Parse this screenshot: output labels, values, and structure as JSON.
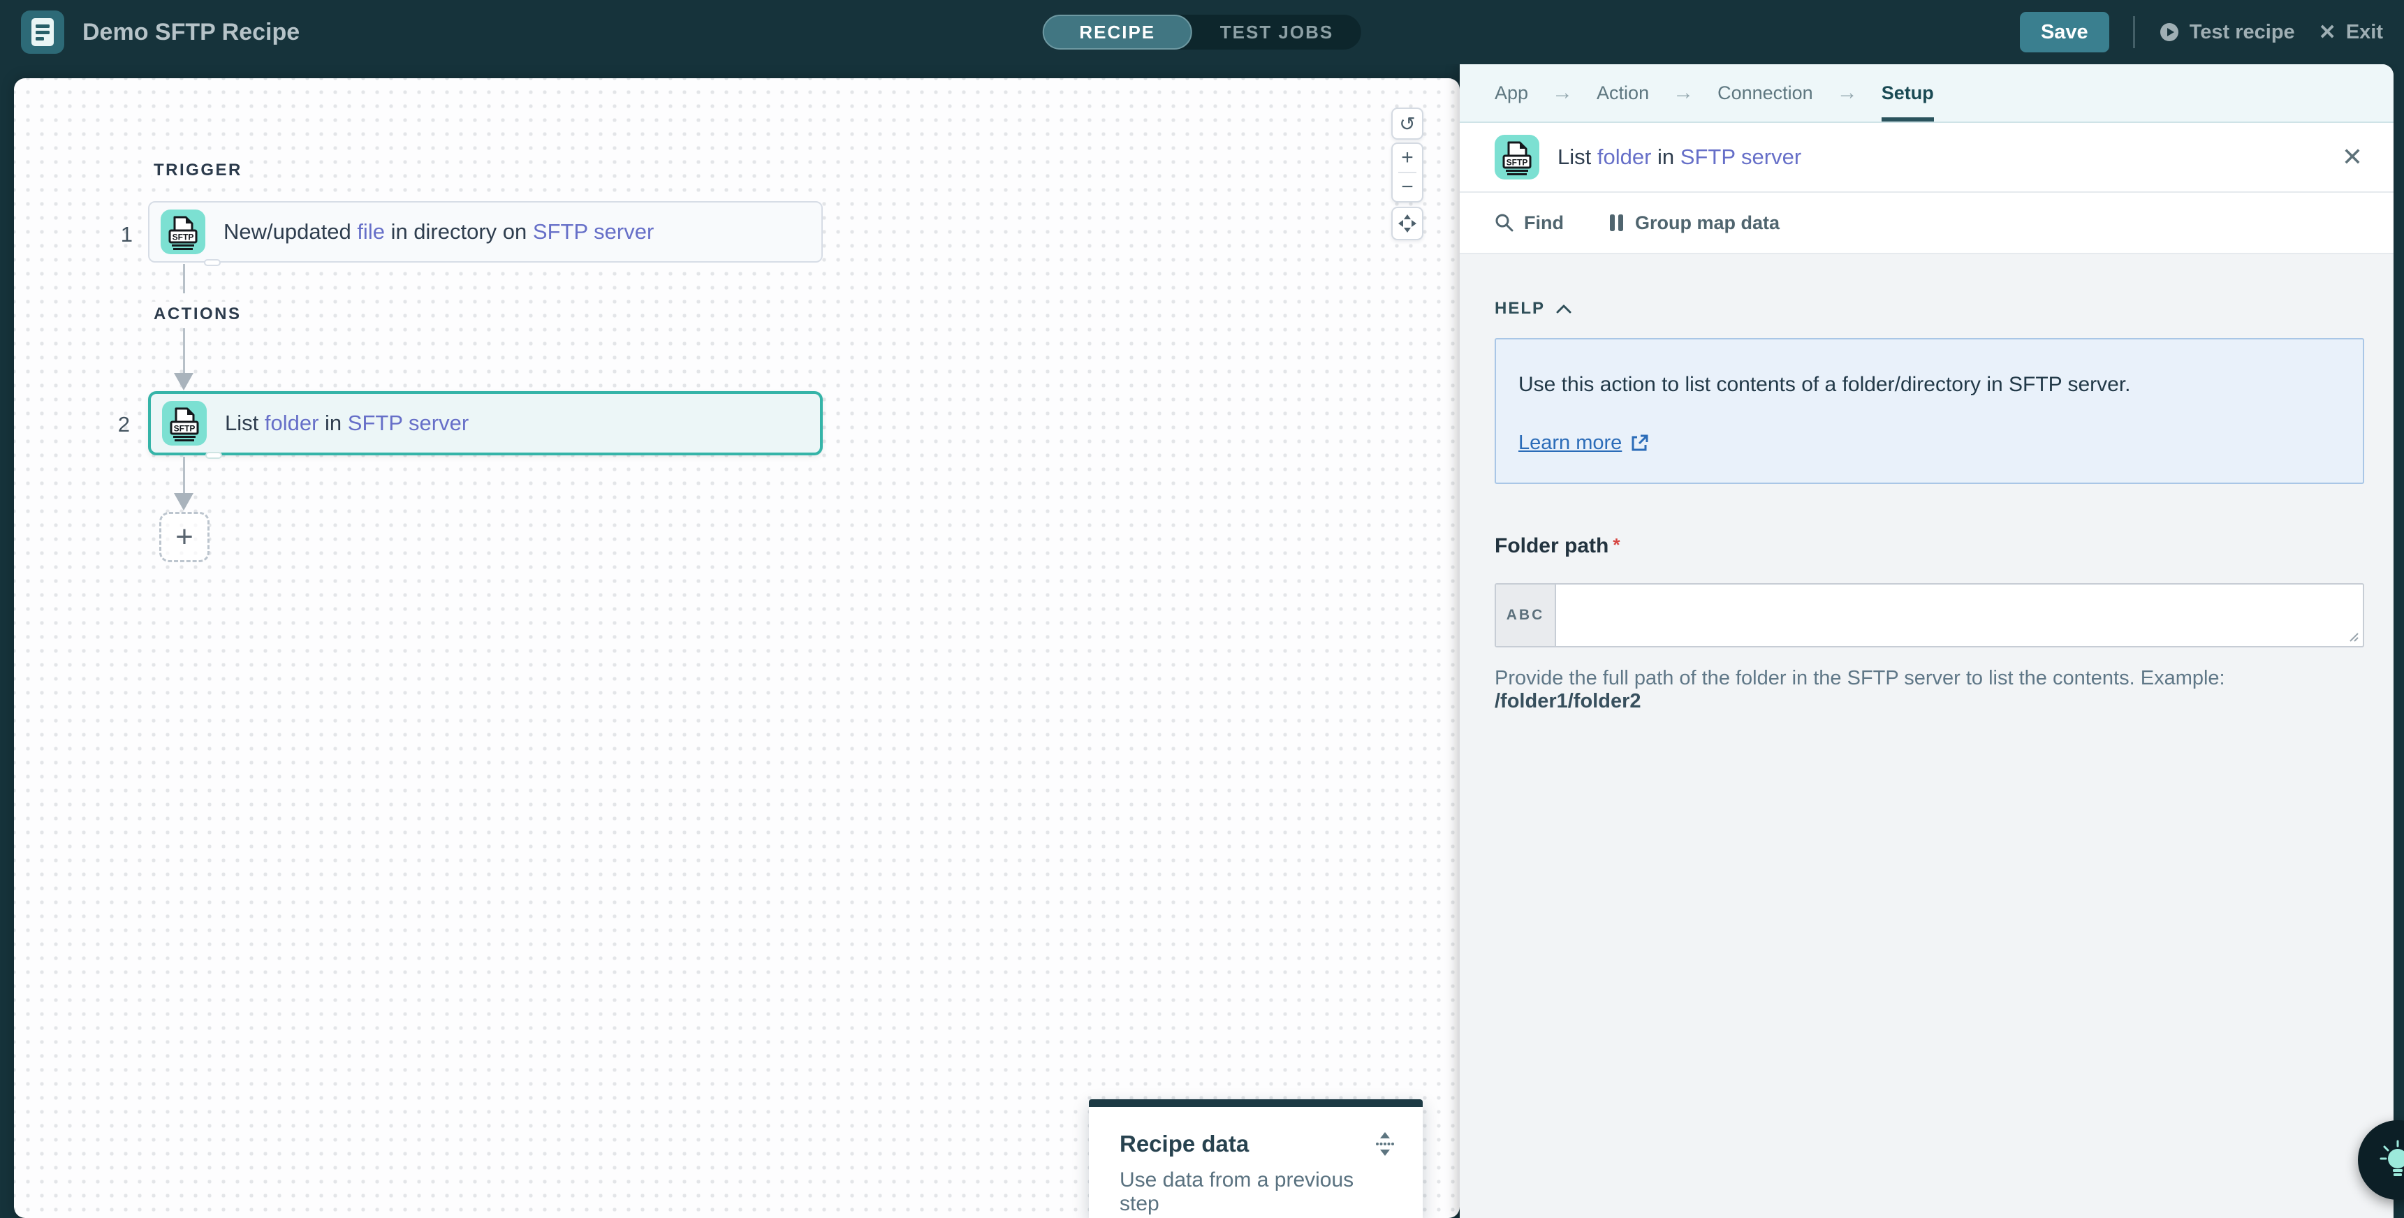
{
  "header": {
    "title": "Demo SFTP Recipe",
    "tabs": [
      {
        "label": "RECIPE"
      },
      {
        "label": "TEST JOBS"
      }
    ],
    "save_label": "Save",
    "test_recipe_label": "Test recipe",
    "exit_label": "Exit",
    "exit_glyph": "✕"
  },
  "canvas": {
    "trigger_label": "TRIGGER",
    "actions_label": "ACTIONS",
    "steps": [
      {
        "number": "1",
        "app": "SFTP",
        "parts": [
          {
            "text": "New/updated "
          },
          {
            "text": "file"
          },
          {
            "text": " in directory on "
          },
          {
            "text": "SFTP server"
          }
        ]
      },
      {
        "number": "2",
        "app": "SFTP",
        "parts": [
          {
            "text": "List "
          },
          {
            "text": "folder"
          },
          {
            "text": " in "
          },
          {
            "text": "SFTP server"
          }
        ]
      }
    ],
    "add_step_label": "+",
    "zoom_controls": {
      "reset": "↺",
      "zoom_in": "+",
      "zoom_out": "−"
    }
  },
  "panel": {
    "breadcrumb": {
      "items": [
        "App",
        "Action",
        "Connection",
        "Setup"
      ],
      "separator": "→"
    },
    "title": {
      "parts": [
        {
          "text": "List "
        },
        {
          "text": "folder"
        },
        {
          "text": " in "
        },
        {
          "text": "SFTP server"
        }
      ],
      "close_glyph": "✕"
    },
    "toolbar": {
      "find_label": "Find",
      "group_map_label": "Group map data"
    },
    "help": {
      "section_label": "HELP",
      "text": "Use this action to list contents of a folder/directory in SFTP server.",
      "learn_more_label": "Learn more"
    },
    "folder_path": {
      "label": "Folder path",
      "required_mark": "*",
      "prefix": "ABC",
      "value": "",
      "helper_text": "Provide the full path of the folder in the SFTP server to list the contents. Example: ",
      "helper_example": "/folder1/folder2"
    }
  },
  "recipe_data": {
    "title": "Recipe data",
    "subtitle": "Use data from a previous step"
  },
  "colors": {
    "header_bg": "#16333b",
    "accent_teal": "#3a7f8f",
    "selected_step_border": "#35b4a8",
    "sftp_icon_bg": "#7ce0d2",
    "link_text": "#666fc8",
    "help_box_bg": "#e9f1fa",
    "help_box_border": "#a9c6e6",
    "learn_more_link": "#2b6cb8",
    "required_mark": "#d64541",
    "panel_body_bg": "#f2f4f6"
  }
}
